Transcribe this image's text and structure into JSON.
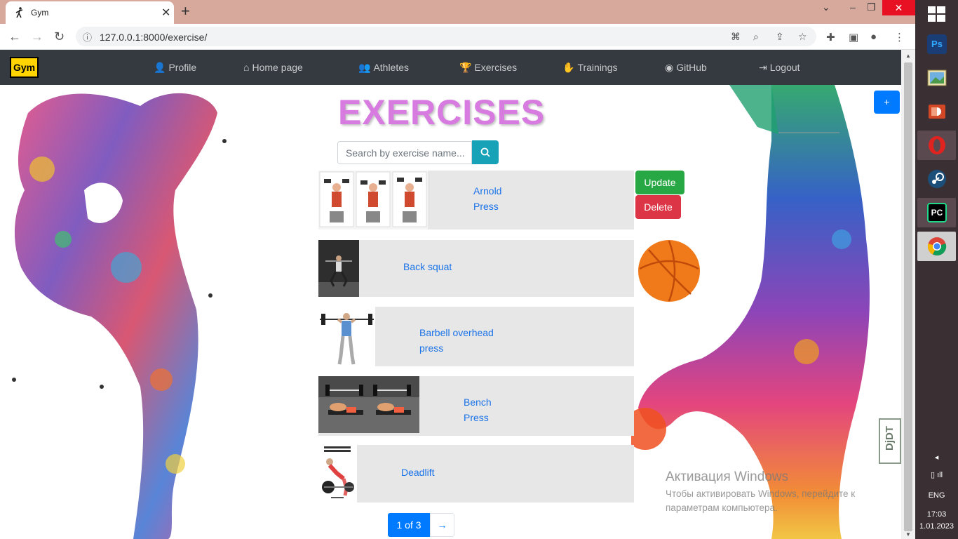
{
  "browser": {
    "tab_title": "Gym",
    "url": "127.0.0.1:8000/exercise/"
  },
  "nav": {
    "brand": "Gym",
    "links": [
      {
        "label": "Profile"
      },
      {
        "label": "Home page"
      },
      {
        "label": "Athletes"
      },
      {
        "label": "Exercises"
      },
      {
        "label": "Trainings"
      },
      {
        "label": "GitHub"
      },
      {
        "label": "Logout"
      }
    ]
  },
  "page": {
    "title": "EXERCISES",
    "search_placeholder": "Search by exercise name...",
    "add_label": "+",
    "update_label": "Update",
    "delete_label": "Delete",
    "exercises": [
      {
        "name": "Arnold Press"
      },
      {
        "name": "Back squat"
      },
      {
        "name": "Barbell overhead press"
      },
      {
        "name": "Bench Press"
      },
      {
        "name": "Deadlift"
      }
    ],
    "pagination": {
      "current": "1 of 3",
      "next": "→"
    }
  },
  "watermark": {
    "heading": "Активация Windows",
    "text": "Чтобы активировать Windows, перейдите к параметрам компьютера."
  },
  "debug_toolbar": {
    "label": "DjDT"
  },
  "taskbar": {
    "apps": [
      {
        "name": "Photoshop",
        "label": "Ps",
        "color": "#1b6fd1"
      },
      {
        "name": "Photos",
        "label": "",
        "color": "#4a9a64"
      },
      {
        "name": "PowerPoint",
        "label": "",
        "color": "#d24726"
      },
      {
        "name": "Opera",
        "label": "O",
        "color": "#e1231f"
      },
      {
        "name": "Steam",
        "label": "",
        "color": "#1b2838"
      },
      {
        "name": "PyCharm",
        "label": "PC",
        "color": "#21d789"
      },
      {
        "name": "Chrome",
        "label": "",
        "color": "#e6e6e6"
      }
    ],
    "language": "ENG",
    "time": "17:03",
    "date": "1.01.2023"
  }
}
